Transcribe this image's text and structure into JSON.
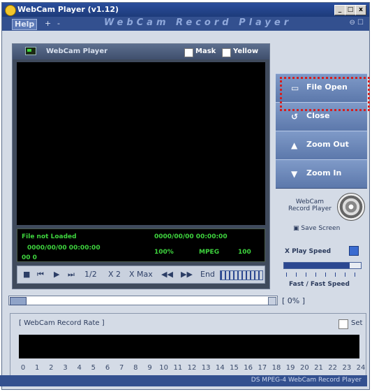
{
  "window": {
    "title": "WebCam Player (v1.12)",
    "controls": [
      "_",
      "□",
      "x"
    ]
  },
  "menubar": {
    "help": "Help",
    "items": [
      "+",
      "-"
    ],
    "banner": "WebCam Record Player",
    "winctl": "⊖ ☐"
  },
  "player": {
    "title": "WebCam Player",
    "options": [
      {
        "label": "Mask",
        "checked": false
      },
      {
        "label": "Yellow",
        "checked": false
      }
    ],
    "status": {
      "file": "File not Loaded",
      "time_left": "0000/00/00 00:00:00",
      "time_right": "0000/00/00 00:00:00",
      "zoom": "100%",
      "format": "MPEG",
      "volume": "100",
      "counter": "00 0"
    },
    "controls": {
      "stop": "■",
      "prev": "⏮",
      "play": "▶",
      "next": "⏭",
      "speed_half": "1/2",
      "speed_x2": "X 2",
      "speed_xmax": "X Max",
      "rewind": "◀◀",
      "fforward": "▶▶",
      "end_label": "End"
    }
  },
  "right_panel": {
    "buttons": [
      {
        "label": "File Open",
        "icon": "folder-icon"
      },
      {
        "label": "Close",
        "icon": "refresh-icon"
      },
      {
        "label": "Zoom Out",
        "icon": "triangle-up-icon"
      },
      {
        "label": "Zoom In",
        "icon": "triangle-down-icon"
      }
    ],
    "logo_line1": "WebCam",
    "logo_line2": "Record Player",
    "save_screen": "Save Screen",
    "speed_label": "X Play Speed",
    "speed_bottom": "Fast / Fast Speed",
    "speed_level": 0.85
  },
  "progress": {
    "percent_text": "[ 0% ]",
    "value": 0
  },
  "rate": {
    "title": "[ WebCam Record Rate ]",
    "set_label": "Set",
    "hours": [
      "0",
      "1",
      "2",
      "3",
      "4",
      "5",
      "6",
      "7",
      "8",
      "9",
      "10",
      "11",
      "12",
      "13",
      "14",
      "15",
      "16",
      "17",
      "18",
      "19",
      "20",
      "21",
      "22",
      "23",
      "24"
    ]
  },
  "footer": {
    "text": "DS MPEG-4 WebCam Record Player"
  }
}
